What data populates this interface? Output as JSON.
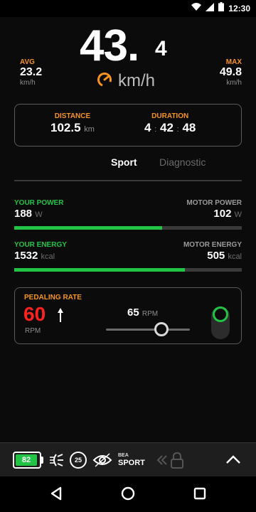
{
  "status_bar": {
    "time": "12:30",
    "icons": [
      "wifi-icon",
      "signal-icon",
      "battery-icon"
    ]
  },
  "speed": {
    "integer": "43.",
    "decimal": "4",
    "unit": "km/h",
    "icon": "speedometer-icon"
  },
  "avg": {
    "label": "AVG",
    "value": "23.2",
    "unit": "km/h"
  },
  "max": {
    "label": "MAX",
    "value": "49.8",
    "unit": "km/h"
  },
  "trip": {
    "distance": {
      "label": "DISTANCE",
      "value": "102.5",
      "unit": "km"
    },
    "duration": {
      "label": "DURATION",
      "hours": "4",
      "minutes": "42",
      "seconds": "48"
    }
  },
  "tabs": {
    "sport": "Sport",
    "diagnostic": "Diagnostic",
    "active": "Sport"
  },
  "power": {
    "left_label": "YOUR POWER",
    "left_value": "188",
    "left_unit": "W",
    "right_label": "MOTOR POWER",
    "right_value": "102",
    "right_unit": "W",
    "fill_fraction": 0.65
  },
  "energy": {
    "left_label": "YOUR ENERGY",
    "left_value": "1532",
    "left_unit": "kcal",
    "right_label": "MOTOR ENERGY",
    "right_value": "505",
    "right_unit": "kcal",
    "fill_fraction": 0.75
  },
  "pedaling": {
    "label": "PEDALING RATE",
    "cadence": "60",
    "cadence_unit": "RPM",
    "target": "65",
    "target_unit": "RPM",
    "slider_fraction": 0.65
  },
  "bottom_bar": {
    "battery": "82",
    "speed_limit": "25",
    "mode_small": "BEA",
    "mode_big": "SPORT"
  },
  "colors": {
    "accent_orange": "#f7941d",
    "green": "#22c445",
    "red": "#ff2020"
  }
}
